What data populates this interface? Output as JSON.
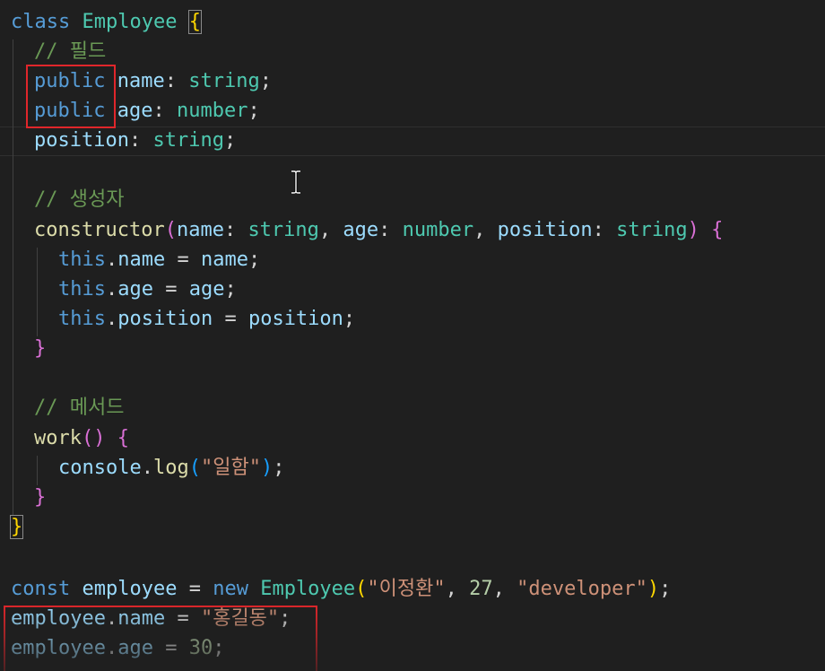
{
  "code": {
    "line1": {
      "kw": "class",
      "name": "Employee",
      "brace": "{"
    },
    "line2": {
      "comment": "// 필드"
    },
    "line3": {
      "mod": "public",
      "prop": "name",
      "colon": ":",
      "type": "string",
      "semi": ";"
    },
    "line4": {
      "mod": "public",
      "prop": "age",
      "colon": ":",
      "type": "number",
      "semi": ";"
    },
    "line5": {
      "prop": "position",
      "colon": ":",
      "type": "string",
      "semi": ";"
    },
    "line7": {
      "comment": "// 생성자"
    },
    "line8": {
      "fn": "constructor",
      "open": "(",
      "p1": "name",
      "c1": ":",
      "t1": "string",
      "sep1": ",",
      "p2": "age",
      "c2": ":",
      "t2": "number",
      "sep2": ",",
      "p3": "position",
      "c3": ":",
      "t3": "string",
      "close": ")",
      "brace": "{"
    },
    "line9": {
      "this": "this",
      "dot": ".",
      "prop": "name",
      "eq": "=",
      "val": "name",
      "semi": ";"
    },
    "line10": {
      "this": "this",
      "dot": ".",
      "prop": "age",
      "eq": "=",
      "val": "age",
      "semi": ";"
    },
    "line11": {
      "this": "this",
      "dot": ".",
      "prop": "position",
      "eq": "=",
      "val": "position",
      "semi": ";"
    },
    "line12": {
      "brace": "}"
    },
    "line14": {
      "comment": "// 메서드"
    },
    "line15": {
      "fn": "work",
      "parens": "()",
      "brace": "{"
    },
    "line16": {
      "obj": "console",
      "dot": ".",
      "fn": "log",
      "open": "(",
      "str": "\"일함\"",
      "close": ")",
      "semi": ";"
    },
    "line17": {
      "brace": "}"
    },
    "line18": {
      "brace": "}"
    },
    "line20": {
      "kw": "const",
      "var": "employee",
      "eq": "=",
      "new": "new",
      "cls": "Employee",
      "open": "(",
      "a1": "\"이정환\"",
      "sep1": ",",
      "a2": "27",
      "sep2": ",",
      "a3": "\"developer\"",
      "close": ")",
      "semi": ";"
    },
    "line21": {
      "var": "employee",
      "dot": ".",
      "prop": "name",
      "eq": "=",
      "str": "\"홍길동\"",
      "semi": ";"
    },
    "line22": {
      "var": "employee",
      "dot": ".",
      "prop": "age",
      "eq": "=",
      "num": "30",
      "semi": ";"
    }
  },
  "colors": {
    "background": "#1f1f1f",
    "keyword": "#569cd6",
    "type": "#4ec9b0",
    "property": "#9cdcfe",
    "function": "#dcdcaa",
    "comment": "#6a9955",
    "string": "#ce9178",
    "number": "#b5cea8",
    "bracket_gold": "#ffd700",
    "bracket_magenta": "#da70d6",
    "bracket_blue": "#179fff",
    "highlight_box": "#e0262b"
  },
  "icons": {
    "mouse_cursor": "text-ibeam-cursor-icon"
  }
}
